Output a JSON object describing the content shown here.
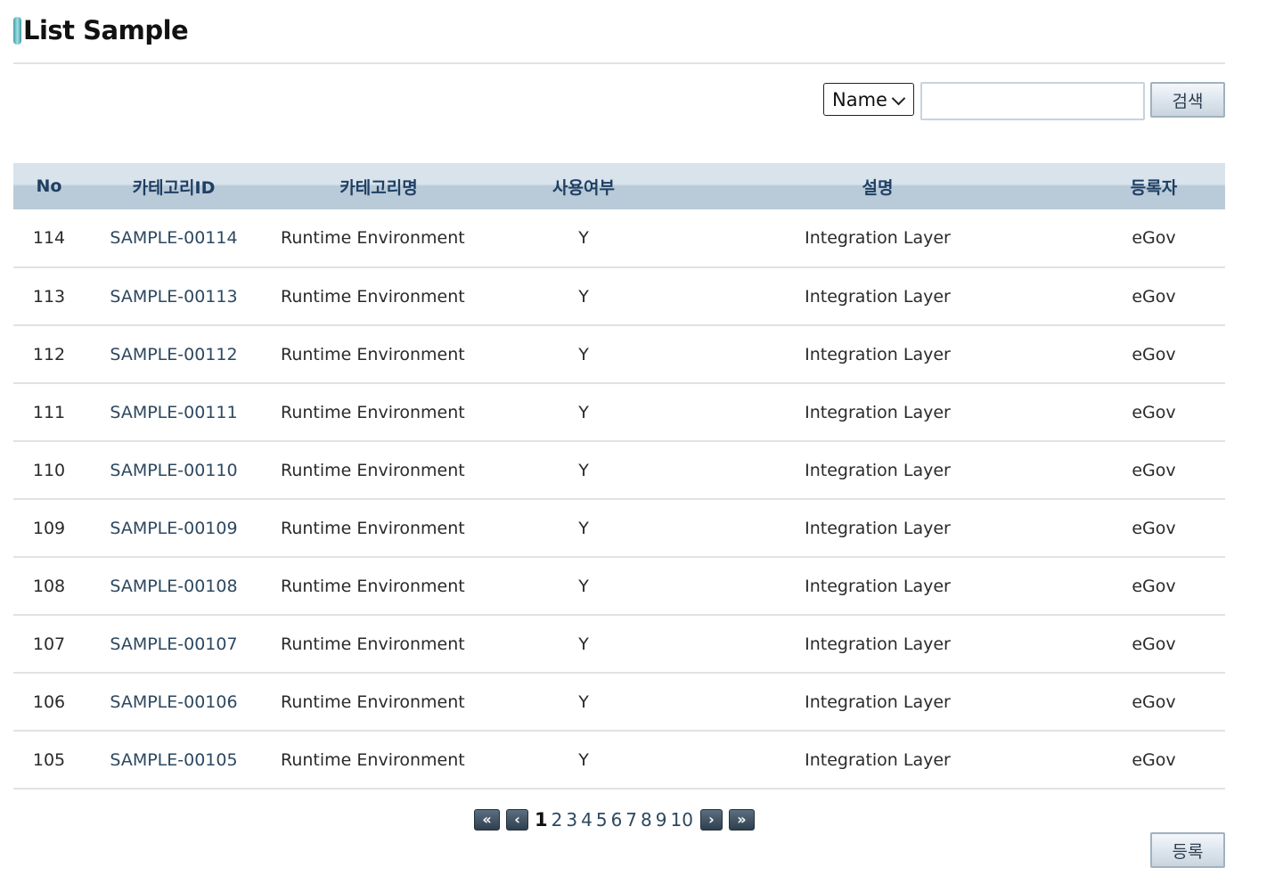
{
  "header": {
    "title": "List Sample"
  },
  "search": {
    "condition_selected": "Name",
    "keyword_value": "",
    "button_label": "검색"
  },
  "table": {
    "columns": [
      "No",
      "카테고리ID",
      "카테고리명",
      "사용여부",
      "설명",
      "등록자"
    ],
    "rows": [
      {
        "no": "114",
        "id": "SAMPLE-00114",
        "name": "Runtime Environment",
        "use": "Y",
        "desc": "Integration Layer",
        "user": "eGov"
      },
      {
        "no": "113",
        "id": "SAMPLE-00113",
        "name": "Runtime Environment",
        "use": "Y",
        "desc": "Integration Layer",
        "user": "eGov"
      },
      {
        "no": "112",
        "id": "SAMPLE-00112",
        "name": "Runtime Environment",
        "use": "Y",
        "desc": "Integration Layer",
        "user": "eGov"
      },
      {
        "no": "111",
        "id": "SAMPLE-00111",
        "name": "Runtime Environment",
        "use": "Y",
        "desc": "Integration Layer",
        "user": "eGov"
      },
      {
        "no": "110",
        "id": "SAMPLE-00110",
        "name": "Runtime Environment",
        "use": "Y",
        "desc": "Integration Layer",
        "user": "eGov"
      },
      {
        "no": "109",
        "id": "SAMPLE-00109",
        "name": "Runtime Environment",
        "use": "Y",
        "desc": "Integration Layer",
        "user": "eGov"
      },
      {
        "no": "108",
        "id": "SAMPLE-00108",
        "name": "Runtime Environment",
        "use": "Y",
        "desc": "Integration Layer",
        "user": "eGov"
      },
      {
        "no": "107",
        "id": "SAMPLE-00107",
        "name": "Runtime Environment",
        "use": "Y",
        "desc": "Integration Layer",
        "user": "eGov"
      },
      {
        "no": "106",
        "id": "SAMPLE-00106",
        "name": "Runtime Environment",
        "use": "Y",
        "desc": "Integration Layer",
        "user": "eGov"
      },
      {
        "no": "105",
        "id": "SAMPLE-00105",
        "name": "Runtime Environment",
        "use": "Y",
        "desc": "Integration Layer",
        "user": "eGov"
      }
    ]
  },
  "pagination": {
    "pages": [
      "1",
      "2",
      "3",
      "4",
      "5",
      "6",
      "7",
      "8",
      "9",
      "10"
    ],
    "current": "1",
    "first_icon": "double-chevron-left-icon",
    "prev_icon": "chevron-left-icon",
    "next_icon": "chevron-right-icon",
    "last_icon": "double-chevron-right-icon"
  },
  "footer": {
    "register_label": "등록"
  },
  "colors": {
    "title_marker": "#3f9aa6",
    "header_bg": "#b9cad8",
    "header_text": "#1f3f63",
    "link_text": "#2d4860"
  }
}
